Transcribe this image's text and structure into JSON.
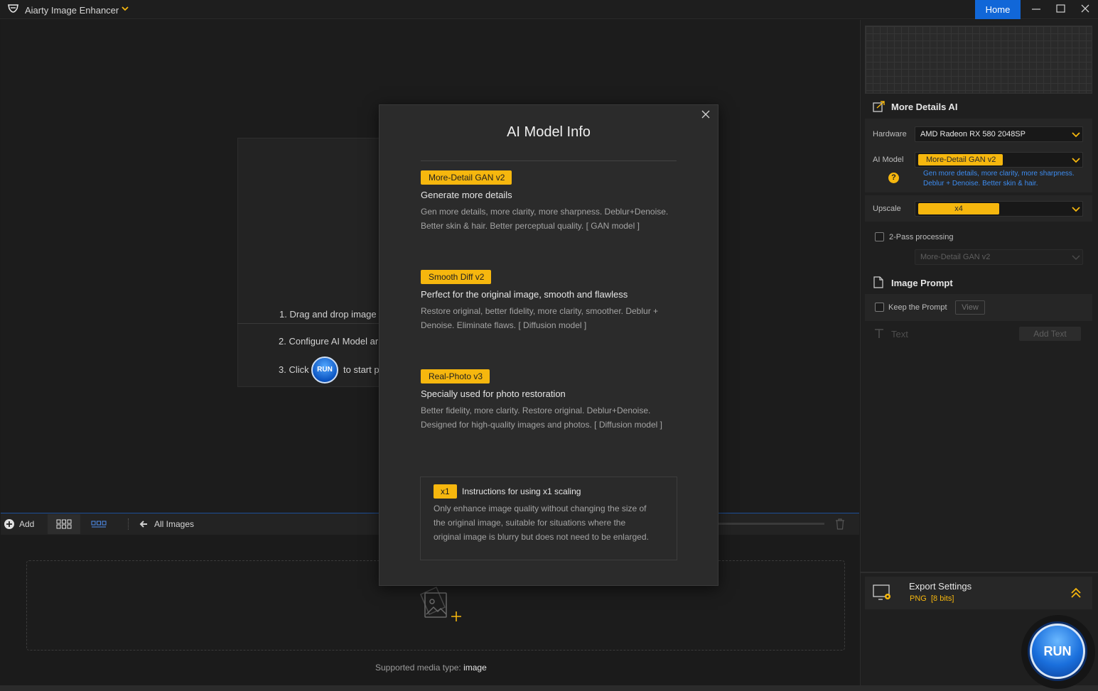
{
  "app": {
    "title": "Aiarty Image Enhancer",
    "home_label": "Home"
  },
  "welcome": {
    "step1": "1. Drag and drop image",
    "step2": "2. Configure AI Model ar",
    "step3_prefix": "3. Click",
    "run_mini": "RUN",
    "step3_suffix": "to start p"
  },
  "thumbbar": {
    "add_label": "Add",
    "all_images": "All Images"
  },
  "drop": {
    "supported_prefix": "Supported media type:",
    "supported_value": "image"
  },
  "panel": {
    "section_title": "More Details AI",
    "hardware_label": "Hardware",
    "hardware_value": "AMD Radeon RX 580 2048SP",
    "ai_model_label": "AI Model",
    "ai_model_value": "More-Detail GAN v2",
    "ai_model_desc_line1": "Gen more details, more clarity, more sharpness.",
    "ai_model_desc_line2": "Deblur + Denoise. Better skin & hair.",
    "help_glyph": "?",
    "upscale_label": "Upscale",
    "upscale_value": "x4",
    "two_pass_label": "2-Pass processing",
    "two_pass_model": "More-Detail GAN v2",
    "prompt_title": "Image Prompt",
    "keep_prompt_label": "Keep the Prompt",
    "view_label": "View",
    "text_label": "Text",
    "add_text_label": "Add Text",
    "export_title": "Export Settings",
    "export_format": "PNG",
    "export_bits": "[8 bits]",
    "run_label": "RUN"
  },
  "modal": {
    "title": "AI Model Info",
    "models": [
      {
        "tag": "More-Detail GAN v2",
        "subtitle": "Generate more details",
        "desc_line1": "Gen more details, more clarity, more sharpness. Deblur+Denoise.",
        "desc_line2": "Better skin & hair. Better perceptual quality.  [ GAN model ]"
      },
      {
        "tag": "Smooth Diff v2",
        "subtitle": "Perfect for the original image, smooth and flawless",
        "desc_line1": "Restore original, better fidelity, more clarity, smoother. Deblur +",
        "desc_line2": "Denoise. Eliminate flaws.  [ Diffusion model ]"
      },
      {
        "tag": "Real-Photo v3",
        "subtitle": "Specially used for photo restoration",
        "desc_line1": "Better fidelity, more clarity. Restore original. Deblur+Denoise.",
        "desc_line2": "Designed for high-quality images and photos.  [ Diffusion model ]"
      }
    ],
    "x1": {
      "tag": "x1",
      "title": "Instructions for using x1 scaling",
      "line1": "Only enhance image quality without changing the size of",
      "line2": "the original image, suitable for situations where the",
      "line3": "original image is blurry but does not need to be enlarged."
    }
  },
  "colors": {
    "accent": "#f6b70e",
    "home_blue": "#1167d8",
    "link_blue": "#3d8cf0"
  },
  "icons": [
    "app-logo-icon",
    "chevron-down-icon",
    "minimize-icon",
    "maximize-icon",
    "close-icon",
    "plus-circle-icon",
    "grid-view-icon",
    "strip-view-icon",
    "back-arrow-icon",
    "trash-icon",
    "add-image-icon",
    "enhance-icon",
    "help-icon",
    "document-icon",
    "text-icon",
    "export-settings-icon",
    "chevron-double-up-icon"
  ]
}
